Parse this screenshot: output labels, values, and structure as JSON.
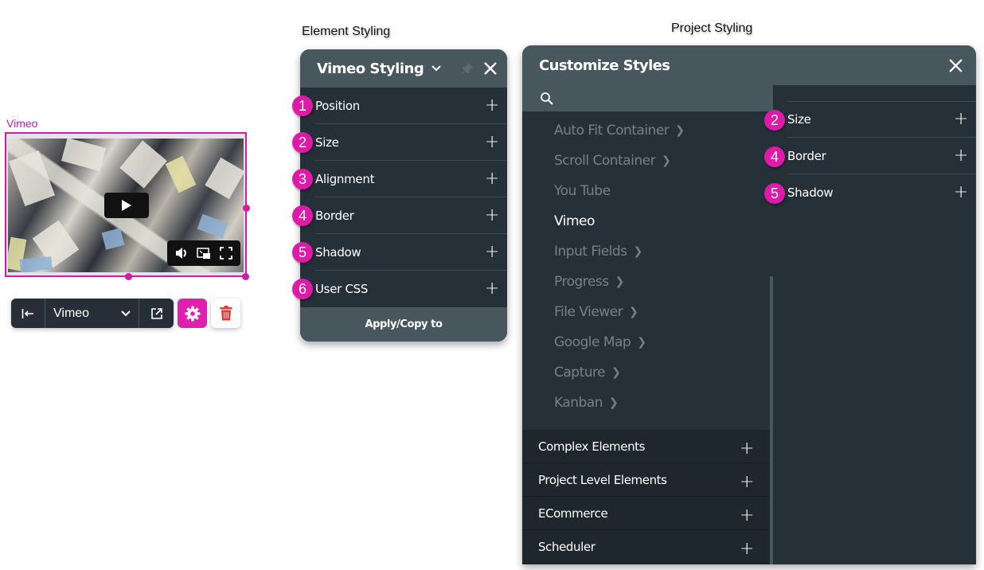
{
  "captions": {
    "element_styling": "Element Styling",
    "project_styling": "Project Styling"
  },
  "vimeo_element": {
    "label": "Vimeo",
    "player_controls": [
      "volume-icon",
      "picture-in-picture-icon",
      "fullscreen-icon"
    ]
  },
  "toolbar": {
    "selected_element": "Vimeo",
    "icons": [
      "collapse-left-icon",
      "chevron-down-icon",
      "external-link-icon",
      "gear-icon",
      "trash-icon"
    ],
    "accent_color": "#e01fb0",
    "delete_color": "#e53935"
  },
  "element_styling_panel": {
    "title": "Vimeo Styling",
    "items": [
      {
        "badge": "1",
        "label": "Position"
      },
      {
        "badge": "2",
        "label": "Size"
      },
      {
        "badge": "3",
        "label": "Alignment"
      },
      {
        "badge": "4",
        "label": "Border"
      },
      {
        "badge": "5",
        "label": "Shadow"
      },
      {
        "badge": "6",
        "label": "User CSS"
      }
    ],
    "footer_button": "Apply/Copy to"
  },
  "customize_styles_panel": {
    "title": "Customize Styles",
    "search_placeholder": "",
    "nav_items": [
      {
        "label": "Auto Fit Container",
        "has_children": true,
        "active": false
      },
      {
        "label": "Scroll Container",
        "has_children": true,
        "active": false
      },
      {
        "label": "You Tube",
        "has_children": false,
        "active": false
      },
      {
        "label": "Vimeo",
        "has_children": false,
        "active": true
      },
      {
        "label": "Input Fields",
        "has_children": true,
        "active": false
      },
      {
        "label": "Progress",
        "has_children": true,
        "active": false
      },
      {
        "label": "File Viewer",
        "has_children": true,
        "active": false
      },
      {
        "label": "Google Map",
        "has_children": true,
        "active": false
      },
      {
        "label": "Capture",
        "has_children": true,
        "active": false
      },
      {
        "label": "Kanban",
        "has_children": true,
        "active": false
      }
    ],
    "groups": [
      {
        "label": "Complex Elements"
      },
      {
        "label": "Project Level Elements"
      },
      {
        "label": "ECommerce"
      },
      {
        "label": "Scheduler"
      }
    ],
    "properties": [
      {
        "badge": "2",
        "label": "Size"
      },
      {
        "badge": "4",
        "label": "Border"
      },
      {
        "badge": "5",
        "label": "Shadow"
      }
    ]
  },
  "colors": {
    "selection_magenta": "#d31ba8",
    "badge_magenta": "#df1aa8",
    "panel_dark": "#263038",
    "panel_header": "#48565e"
  }
}
